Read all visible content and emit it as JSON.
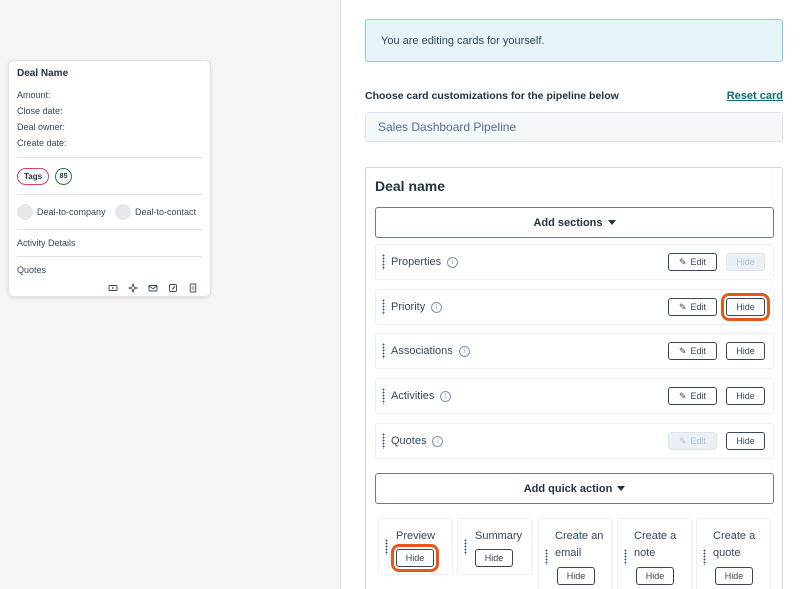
{
  "preview_card": {
    "title": "Deal Name",
    "fields": [
      "Amount:",
      "Close date:",
      "Deal owner:",
      "Create date:"
    ],
    "tag_label": "Tags",
    "score": "85",
    "associations": [
      "Deal-to-company",
      "Deal-to-contact"
    ],
    "sections": [
      "Activity Details",
      "Quotes"
    ],
    "action_icons": [
      "video-icon",
      "sparkle-icon",
      "email-icon",
      "note-icon",
      "calendar-icon"
    ]
  },
  "alert": {
    "text": "You are editing cards for yourself."
  },
  "customization": {
    "label": "Choose card customizations for the pipeline below",
    "reset_label": "Reset card",
    "pipeline_value": "Sales Dashboard Pipeline"
  },
  "editor": {
    "title": "Deal name",
    "add_sections_label": "Add sections",
    "add_quick_action_label": "Add quick action",
    "edit_label": "Edit",
    "hide_label": "Hide",
    "sections": [
      {
        "label": "Properties",
        "edit_disabled": false,
        "hide_disabled": true,
        "highlighted": false
      },
      {
        "label": "Priority",
        "edit_disabled": false,
        "hide_disabled": false,
        "highlighted": true
      },
      {
        "label": "Associations",
        "edit_disabled": false,
        "hide_disabled": false,
        "highlighted": false
      },
      {
        "label": "Activities",
        "edit_disabled": false,
        "hide_disabled": false,
        "highlighted": false
      },
      {
        "label": "Quotes",
        "edit_disabled": true,
        "hide_disabled": false,
        "highlighted": false
      }
    ],
    "quick_actions": [
      {
        "line1": "Preview",
        "line2": "",
        "highlighted": true
      },
      {
        "line1": "Summary",
        "line2": "",
        "highlighted": false
      },
      {
        "line1": "Create an",
        "line2": "email",
        "highlighted": false
      },
      {
        "line1": "Create a",
        "line2": "note",
        "highlighted": false
      },
      {
        "line1": "Create a",
        "line2": "quote",
        "highlighted": false
      }
    ]
  },
  "colors": {
    "highlight": "#e8561c",
    "alert_bg": "#e5f5f8",
    "alert_border": "#7fd1de",
    "link": "#0b6b6f",
    "tag_border": "#d9435f",
    "score_border": "#1b7f3b"
  }
}
